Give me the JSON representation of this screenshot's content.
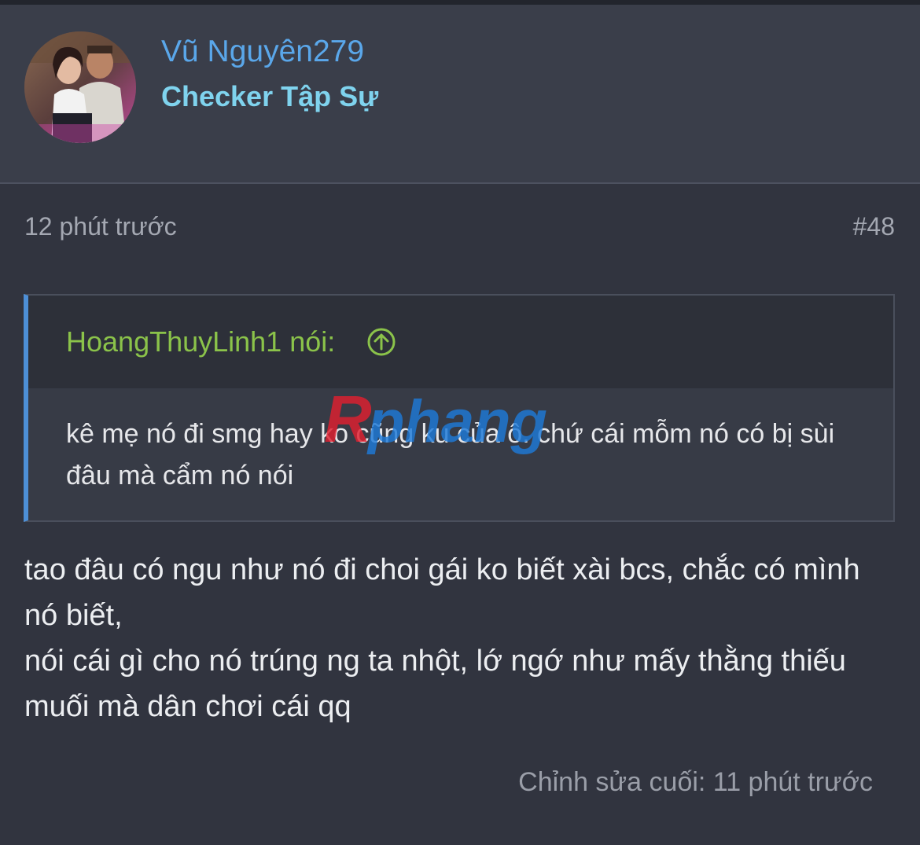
{
  "user": {
    "name": "Vũ Nguyên279",
    "title": "Checker Tập Sự"
  },
  "post": {
    "time": "12 phút trước",
    "number": "#48",
    "quote": {
      "author": "HoangThuyLinh1 nói:",
      "body": "kê mẹ nó đi smg hay ko cũng ku của ô. chứ cái mỗm nó có bị sùi đâu mà cẩm nó nói"
    },
    "body_lines": [
      "tao đâu có ngu như nó đi choi gái ko biết xài bcs, chắc có mình nó biết,",
      "nói cái gì cho nó trúng ng ta nhột, lớ ngớ như mấy thằng thiếu muối mà dân chơi cái qq"
    ],
    "last_edited": "Chỉnh sửa cuối: 11 phút trước"
  },
  "watermark": {
    "text": "Rphang",
    "colors": {
      "first": "#e02030",
      "rest": "#1e7ad8"
    }
  },
  "colors": {
    "background": "#31343f",
    "header_background": "#3a3e4a",
    "username": "#5aa7ea",
    "user_title": "#7fd3ee",
    "quote_author": "#8bc34a",
    "quote_border": "#4d8fd6"
  },
  "icons": {
    "quote_jump": "arrow-up-circle-icon",
    "avatar": "user-avatar-photo"
  }
}
